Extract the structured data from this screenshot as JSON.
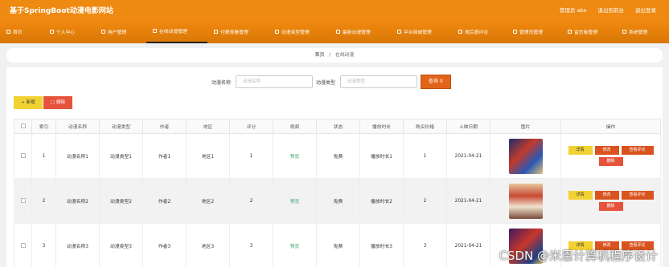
{
  "header": {
    "title": "基于SpringBoot动漫电影网站",
    "admin": "管理员 abo",
    "back_link": "退出到前台",
    "logout": "退出登录"
  },
  "nav": {
    "items": [
      {
        "label": "首页",
        "active": false
      },
      {
        "label": "个人中心",
        "active": false
      },
      {
        "label": "用户管理",
        "active": false
      },
      {
        "label": "在线动漫管理",
        "active": true
      },
      {
        "label": "付费观看管理",
        "active": false
      },
      {
        "label": "动漫类型管理",
        "active": false
      },
      {
        "label": "最新动漫管理",
        "active": false
      },
      {
        "label": "平台商城管理",
        "active": false
      },
      {
        "label": "观后感评论",
        "active": false
      },
      {
        "label": "管理员管理",
        "active": false
      },
      {
        "label": "留言板管理",
        "active": false
      },
      {
        "label": "系统管理",
        "active": false
      }
    ]
  },
  "breadcrumb": {
    "home": "首页",
    "sep": "/",
    "current": "在线动漫"
  },
  "search": {
    "name_label": "动漫名称",
    "name_placeholder": "动漫名称",
    "type_label": "动漫类型",
    "type_placeholder": "动漫类型",
    "button": "查询"
  },
  "actions": {
    "add": "+ 新增",
    "delete": "删除"
  },
  "table": {
    "headers": [
      "索引",
      "动漫名称",
      "动漫类型",
      "作者",
      "地区",
      "评分",
      "视频",
      "状态",
      "播放时长",
      "购买价格",
      "上映日期",
      "图片",
      "操作"
    ],
    "rows": [
      {
        "index": "1",
        "name": "动漫名称1",
        "type": "动漫类型1",
        "author": "作者1",
        "region": "地区1",
        "score": "1",
        "video": "预览",
        "status": "免费",
        "duration": "播放时长1",
        "price": "1",
        "date": "2021-04-21"
      },
      {
        "index": "2",
        "name": "动漫名称2",
        "type": "动漫类型2",
        "author": "作者2",
        "region": "地区2",
        "score": "2",
        "video": "预览",
        "status": "免费",
        "duration": "播放时长2",
        "price": "2",
        "date": "2021-04-21"
      },
      {
        "index": "3",
        "name": "动漫名称3",
        "type": "动漫类型3",
        "author": "作者3",
        "region": "地区3",
        "score": "3",
        "video": "预览",
        "status": "免费",
        "duration": "播放时长3",
        "price": "3",
        "date": "2021-04-21"
      }
    ],
    "row_ops": {
      "detail": "详情",
      "edit": "修改",
      "review": "查看评论",
      "remove": "删除"
    }
  },
  "watermark": "CSDN @米恩计算机程序设计",
  "colors": {
    "brand_orange": "#ee8a12",
    "button_red": "#e2641a",
    "button_yellow": "#f2d232",
    "video_green": "#3aa56e"
  }
}
